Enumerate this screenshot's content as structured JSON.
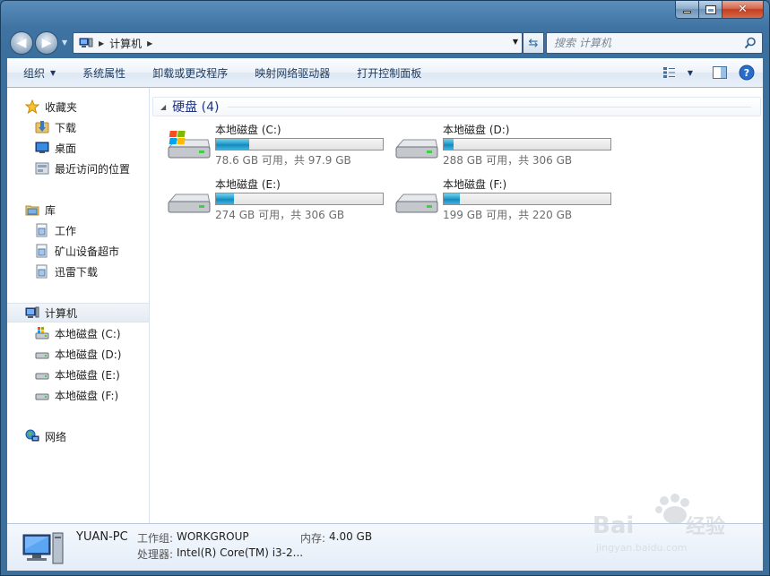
{
  "addressbar": {
    "crumb": "计算机"
  },
  "search": {
    "placeholder": "搜索 计算机"
  },
  "toolbar": {
    "organize": "组织",
    "system_properties": "系统属性",
    "uninstall": "卸载或更改程序",
    "map_drive": "映射网络驱动器",
    "control_panel": "打开控制面板"
  },
  "nav": {
    "favorites": "收藏夹",
    "downloads": "下载",
    "desktop": "桌面",
    "recent": "最近访问的位置",
    "libraries": "库",
    "lib_work": "工作",
    "lib_mine": "矿山设备超市",
    "lib_xunlei": "迅雷下载",
    "computer": "计算机",
    "drive_c": "本地磁盘 (C:)",
    "drive_d": "本地磁盘 (D:)",
    "drive_e": "本地磁盘 (E:)",
    "drive_f": "本地磁盘 (F:)",
    "network": "网络"
  },
  "main": {
    "group_title": "硬盘 (4)",
    "drives": [
      {
        "name": "本地磁盘 (C:)",
        "free": "78.6 GB 可用，共 97.9 GB",
        "used_fraction": 0.197
      },
      {
        "name": "本地磁盘 (D:)",
        "free": "288 GB 可用，共 306 GB",
        "used_fraction": 0.059
      },
      {
        "name": "本地磁盘 (E:)",
        "free": "274 GB 可用，共 306 GB",
        "used_fraction": 0.105
      },
      {
        "name": "本地磁盘 (F:)",
        "free": "199 GB 可用，共 220 GB",
        "used_fraction": 0.095
      }
    ]
  },
  "details": {
    "pc_name": "YUAN-PC",
    "workgroup_label": "工作组:",
    "workgroup": "WORKGROUP",
    "memory_label": "内存:",
    "memory": "4.00 GB",
    "cpu_label": "处理器:",
    "cpu": "Intel(R) Core(TM) i3-2..."
  },
  "colors": {
    "accent": "#1e3287",
    "bar_fill": "#26a0d0",
    "frame": "#3e73a3"
  }
}
